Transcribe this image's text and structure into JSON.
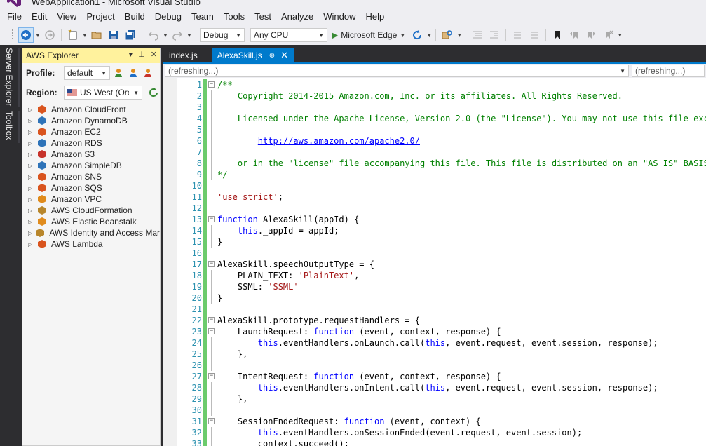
{
  "window": {
    "title": "WebApplication1 - Microsoft Visual Studio"
  },
  "menu": [
    "File",
    "Edit",
    "View",
    "Project",
    "Build",
    "Debug",
    "Team",
    "Tools",
    "Test",
    "Analyze",
    "Window",
    "Help"
  ],
  "toolbar": {
    "configuration": "Debug",
    "platform": "Any CPU",
    "run_target": "Microsoft Edge"
  },
  "side_tabs": [
    "Server Explorer",
    "Toolbox"
  ],
  "aws_explorer": {
    "title": "AWS Explorer",
    "profile_label": "Profile:",
    "profile_value": "default",
    "region_label": "Region:",
    "region_value": "US West (Ore",
    "services": [
      {
        "name": "Amazon CloudFront",
        "color": "#d9541e"
      },
      {
        "name": "Amazon DynamoDB",
        "color": "#2e73b8"
      },
      {
        "name": "Amazon EC2",
        "color": "#d9541e"
      },
      {
        "name": "Amazon RDS",
        "color": "#2e73b8"
      },
      {
        "name": "Amazon S3",
        "color": "#c7332b"
      },
      {
        "name": "Amazon SimpleDB",
        "color": "#2e73b8"
      },
      {
        "name": "Amazon SNS",
        "color": "#d9541e"
      },
      {
        "name": "Amazon SQS",
        "color": "#d9541e"
      },
      {
        "name": "Amazon VPC",
        "color": "#e08b1c"
      },
      {
        "name": "AWS CloudFormation",
        "color": "#b8862b"
      },
      {
        "name": "AWS Elastic Beanstalk",
        "color": "#e08b1c"
      },
      {
        "name": "AWS Identity and Access Mar",
        "color": "#b8862b"
      },
      {
        "name": "AWS Lambda",
        "color": "#d9541e"
      }
    ]
  },
  "doc_tabs": [
    {
      "label": "index.js",
      "active": false
    },
    {
      "label": "AlexaSkill.js",
      "active": true,
      "pin": "⊕",
      "close": "✕"
    }
  ],
  "nav_bar": {
    "left": "(refreshing...)",
    "right": "(refreshing...)"
  },
  "code_lines": [
    {
      "n": "1",
      "fold": "minus",
      "segs": [
        {
          "c": "cm",
          "t": "/**"
        }
      ]
    },
    {
      "n": "2",
      "fold": "line",
      "segs": [
        {
          "c": "cm",
          "t": "    Copyright 2014-2015 Amazon.com, Inc. or its affiliates. All Rights Reserved."
        }
      ]
    },
    {
      "n": "3",
      "fold": "line",
      "segs": []
    },
    {
      "n": "4",
      "fold": "line",
      "segs": [
        {
          "c": "cm",
          "t": "    Licensed under the Apache License, Version 2.0 (the \"License\"). You may not use this file except"
        }
      ]
    },
    {
      "n": "5",
      "fold": "line",
      "segs": []
    },
    {
      "n": "6",
      "fold": "line",
      "segs": [
        {
          "c": "cm",
          "t": "        "
        },
        {
          "c": "cm-link",
          "t": "http://aws.amazon.com/apache2.0/"
        }
      ]
    },
    {
      "n": "7",
      "fold": "line",
      "segs": []
    },
    {
      "n": "8",
      "fold": "line",
      "segs": [
        {
          "c": "cm",
          "t": "    or in the \"license\" file accompanying this file. This file is distributed on an \"AS IS\" BASIS, W"
        }
      ]
    },
    {
      "n": "9",
      "fold": "line",
      "segs": [
        {
          "c": "cm",
          "t": "*/"
        }
      ]
    },
    {
      "n": "10",
      "fold": "",
      "segs": []
    },
    {
      "n": "11",
      "fold": "",
      "segs": [
        {
          "c": "str",
          "t": "'use strict'"
        },
        {
          "c": "pl",
          "t": ";"
        }
      ]
    },
    {
      "n": "12",
      "fold": "",
      "segs": []
    },
    {
      "n": "13",
      "fold": "minus",
      "segs": [
        {
          "c": "kw",
          "t": "function"
        },
        {
          "c": "pl",
          "t": " AlexaSkill(appId) {"
        }
      ]
    },
    {
      "n": "14",
      "fold": "line",
      "segs": [
        {
          "c": "pl",
          "t": "    "
        },
        {
          "c": "kw",
          "t": "this"
        },
        {
          "c": "pl",
          "t": "._appId = appId;"
        }
      ]
    },
    {
      "n": "15",
      "fold": "line",
      "segs": [
        {
          "c": "pl",
          "t": "}"
        }
      ]
    },
    {
      "n": "16",
      "fold": "",
      "segs": []
    },
    {
      "n": "17",
      "fold": "minus",
      "segs": [
        {
          "c": "pl",
          "t": "AlexaSkill.speechOutputType = {"
        }
      ]
    },
    {
      "n": "18",
      "fold": "line",
      "segs": [
        {
          "c": "pl",
          "t": "    PLAIN_TEXT: "
        },
        {
          "c": "str",
          "t": "'PlainText'"
        },
        {
          "c": "pl",
          "t": ","
        }
      ]
    },
    {
      "n": "19",
      "fold": "line",
      "segs": [
        {
          "c": "pl",
          "t": "    SSML: "
        },
        {
          "c": "str",
          "t": "'SSML'"
        }
      ]
    },
    {
      "n": "20",
      "fold": "line",
      "segs": [
        {
          "c": "pl",
          "t": "}"
        }
      ]
    },
    {
      "n": "21",
      "fold": "",
      "segs": []
    },
    {
      "n": "22",
      "fold": "minus",
      "segs": [
        {
          "c": "pl",
          "t": "AlexaSkill.prototype.requestHandlers = {"
        }
      ]
    },
    {
      "n": "23",
      "fold": "minus",
      "segs": [
        {
          "c": "pl",
          "t": "    LaunchRequest: "
        },
        {
          "c": "kw",
          "t": "function"
        },
        {
          "c": "pl",
          "t": " (event, context, response) {"
        }
      ]
    },
    {
      "n": "24",
      "fold": "line",
      "segs": [
        {
          "c": "pl",
          "t": "        "
        },
        {
          "c": "kw",
          "t": "this"
        },
        {
          "c": "pl",
          "t": ".eventHandlers.onLaunch.call("
        },
        {
          "c": "kw",
          "t": "this"
        },
        {
          "c": "pl",
          "t": ", event.request, event.session, response);"
        }
      ]
    },
    {
      "n": "25",
      "fold": "line",
      "segs": [
        {
          "c": "pl",
          "t": "    },"
        }
      ]
    },
    {
      "n": "26",
      "fold": "line",
      "segs": []
    },
    {
      "n": "27",
      "fold": "minus",
      "segs": [
        {
          "c": "pl",
          "t": "    IntentRequest: "
        },
        {
          "c": "kw",
          "t": "function"
        },
        {
          "c": "pl",
          "t": " (event, context, response) {"
        }
      ]
    },
    {
      "n": "28",
      "fold": "line",
      "segs": [
        {
          "c": "pl",
          "t": "        "
        },
        {
          "c": "kw",
          "t": "this"
        },
        {
          "c": "pl",
          "t": ".eventHandlers.onIntent.call("
        },
        {
          "c": "kw",
          "t": "this"
        },
        {
          "c": "pl",
          "t": ", event.request, event.session, response);"
        }
      ]
    },
    {
      "n": "29",
      "fold": "line",
      "segs": [
        {
          "c": "pl",
          "t": "    },"
        }
      ]
    },
    {
      "n": "30",
      "fold": "line",
      "segs": []
    },
    {
      "n": "31",
      "fold": "minus",
      "segs": [
        {
          "c": "pl",
          "t": "    SessionEndedRequest: "
        },
        {
          "c": "kw",
          "t": "function"
        },
        {
          "c": "pl",
          "t": " (event, context) {"
        }
      ]
    },
    {
      "n": "32",
      "fold": "line",
      "segs": [
        {
          "c": "pl",
          "t": "        "
        },
        {
          "c": "kw",
          "t": "this"
        },
        {
          "c": "pl",
          "t": ".eventHandlers.onSessionEnded(event.request, event.session);"
        }
      ]
    },
    {
      "n": "33",
      "fold": "line",
      "segs": [
        {
          "c": "pl",
          "t": "        context.succeed();"
        }
      ]
    }
  ]
}
